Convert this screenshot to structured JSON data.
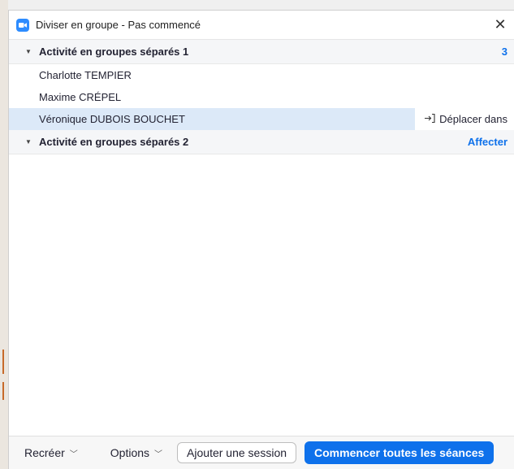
{
  "window": {
    "title": "Diviser en groupe - Pas commencé",
    "close_glyph": "✕",
    "app_icon": "zoom-camera-icon"
  },
  "rooms": [
    {
      "name": "Activité en groupes séparés 1",
      "right_label": "3",
      "expanded": true,
      "participants": [
        {
          "name": "Charlotte TEMPIER",
          "selected": false
        },
        {
          "name": "Maxime CRÉPEL",
          "selected": false
        },
        {
          "name": "Véronique DUBOIS BOUCHET",
          "selected": true,
          "action_label": "Déplacer dans"
        }
      ]
    },
    {
      "name": "Activité en groupes séparés 2",
      "right_label": "Affecter",
      "expanded": true,
      "participants": []
    }
  ],
  "footer": {
    "recreate_label": "Recréer",
    "options_label": "Options",
    "add_session_label": "Ajouter une session",
    "start_all_label": "Commencer toutes les séances"
  },
  "colors": {
    "accent": "#0e71eb",
    "selected_row": "#dce9f8",
    "room_header_bg": "#f5f6f8"
  }
}
